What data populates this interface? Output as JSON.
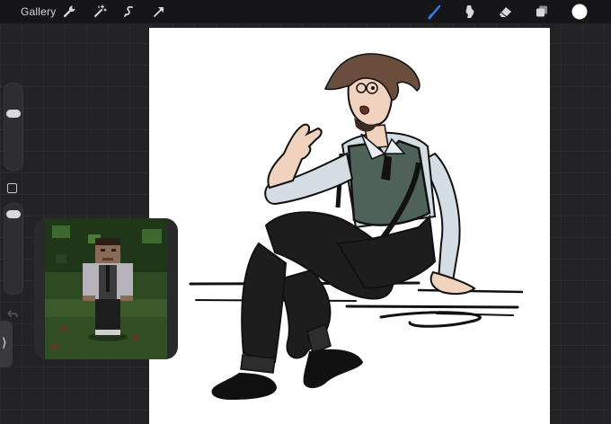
{
  "topbar": {
    "gallery_label": "Gallery",
    "left_tools": [
      "wrench-icon",
      "magic-wand-icon",
      "selection-icon",
      "transform-arrow-icon"
    ],
    "right_tools": [
      "brush-icon",
      "smudge-icon",
      "eraser-icon",
      "layers-icon",
      "color-swatch"
    ],
    "active_tool": "brush-icon",
    "accent_color": "#2f7cf6",
    "current_color": "#ffffff"
  },
  "sidebar": {
    "brush_size": 0.6,
    "brush_opacity": 0.95
  },
  "reference": {
    "shown": true
  }
}
